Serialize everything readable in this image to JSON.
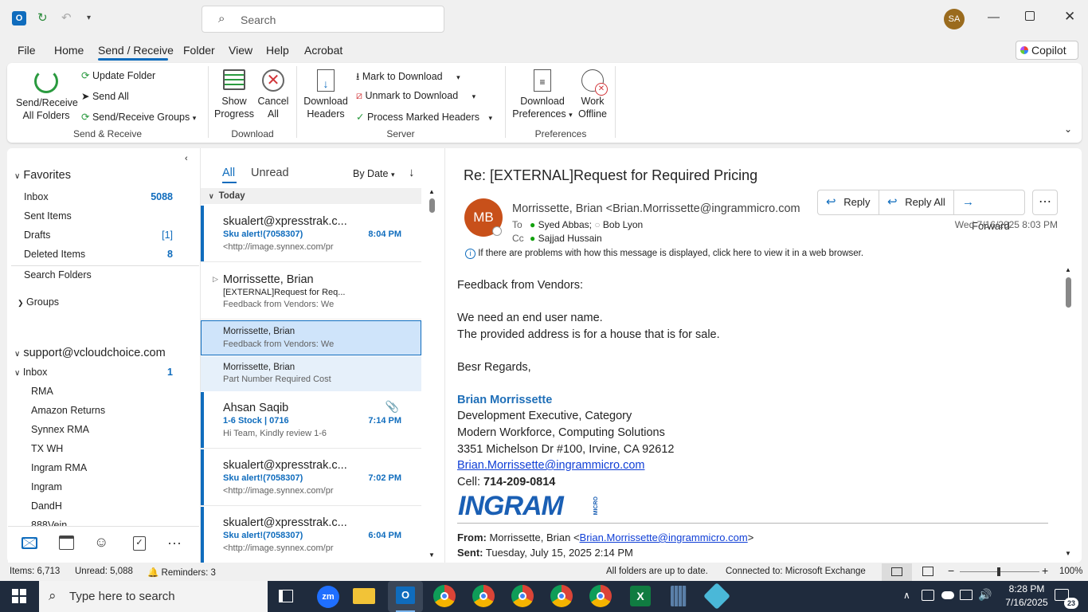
{
  "titlebar": {
    "search_placeholder": "Search",
    "avatar_initials": "SA"
  },
  "menu": {
    "tabs": [
      "File",
      "Home",
      "Send / Receive",
      "Folder",
      "View",
      "Help",
      "Acrobat"
    ],
    "active": "Send / Receive",
    "copilot_label": "Copilot"
  },
  "ribbon": {
    "send_receive_all": [
      "Send/Receive",
      "All Folders"
    ],
    "update_folder": "Update Folder",
    "send_all": "Send All",
    "send_receive_groups": "Send/Receive Groups",
    "group_send_receive": "Send & Receive",
    "show_progress": [
      "Show",
      "Progress"
    ],
    "cancel_all": [
      "Cancel",
      "All"
    ],
    "group_download": "Download",
    "download_headers": [
      "Download",
      "Headers"
    ],
    "mark_to_download": "Mark to Download",
    "unmark_to_download": "Unmark to Download",
    "process_marked_headers": "Process Marked Headers",
    "group_server": "Server",
    "download_preferences": [
      "Download",
      "Preferences"
    ],
    "work_offline": [
      "Work",
      "Offline"
    ],
    "group_preferences": "Preferences"
  },
  "nav": {
    "favorites_label": "Favorites",
    "favorites": [
      {
        "label": "Inbox",
        "count": "5088"
      },
      {
        "label": "Sent Items",
        "count": ""
      },
      {
        "label": "Drafts",
        "count": "[1]"
      },
      {
        "label": "Deleted Items",
        "count": "8"
      }
    ],
    "search_folders": "Search Folders",
    "groups_label": "Groups",
    "account": "support@vcloudchoice.com",
    "inbox_label": "Inbox",
    "inbox_count": "1",
    "subfolders": [
      "RMA",
      "Amazon Returns",
      "Synnex RMA",
      "TX WH",
      "Ingram RMA",
      "Ingram",
      "DandH",
      "888Vein"
    ]
  },
  "list": {
    "tab_all": "All",
    "tab_unread": "Unread",
    "sort_label": "By Date",
    "group_today": "Today",
    "messages": [
      {
        "from": "skualert@xpresstrak.c...",
        "subject": "Sku alert!(7058307)",
        "preview": "<http://image.synnex.com/pr",
        "time": "8:04 PM"
      },
      {
        "from": "Morrissette, Brian",
        "subject": "[EXTERNAL]Request for Req...",
        "preview": "Feedback from Vendors:  We",
        "time": ""
      },
      {
        "from": "Morrissette, Brian",
        "subject": "",
        "preview": "Feedback from Vendors:  We",
        "time": ""
      },
      {
        "from": "Morrissette, Brian",
        "subject": "",
        "preview": "Part Number  Required Cost",
        "time": ""
      },
      {
        "from": "Ahsan Saqib",
        "subject": "1-6 Stock | 0716",
        "preview": "Hi Team,  Kindly review 1-6",
        "time": "7:14 PM"
      },
      {
        "from": "skualert@xpresstrak.c...",
        "subject": "Sku alert!(7058307)",
        "preview": "<http://image.synnex.com/pr",
        "time": "7:02 PM"
      },
      {
        "from": "skualert@xpresstrak.c...",
        "subject": "Sku alert!(7058307)",
        "preview": "<http://image.synnex.com/pr",
        "time": "6:04 PM"
      }
    ]
  },
  "reading": {
    "subject": "Re: [EXTERNAL]Request for Required Pricing",
    "avatar_initials": "MB",
    "sender": "Morrissette, Brian <Brian.Morrissette@ingrammicro.com>",
    "to_label": "To",
    "to_1": "Syed Abbas;",
    "to_2": "Bob Lyon",
    "cc_label": "Cc",
    "cc_1": "Sajjad Hussain",
    "date": "Wed 7/16/2025 8:03 PM",
    "reply": "Reply",
    "reply_all": "Reply All",
    "forward": "Forward",
    "info_bar": "If there are problems with how this message is displayed, click here to view it in a web browser.",
    "body_1": "Feedback from Vendors:",
    "body_2": "We need an end user name.",
    "body_3": "The provided address is for a house that is for sale.",
    "body_4": "Besr Regards,",
    "sig_name": "Brian Morrissette",
    "sig_title": "Development Executive, Category",
    "sig_dept": "Modern Workforce, Computing Solutions",
    "sig_addr": "3351 Michelson Dr #100, Irvine, CA 92612",
    "sig_email": "Brian.Morrissette@ingrammicro.com",
    "sig_cell_label": "Cell:",
    "sig_cell": "714-209-0814",
    "logo_text": "INGRAM",
    "logo_sub": "MICRO",
    "quote_from_label": "From:",
    "quote_from_name": "Morrissette, Brian <",
    "quote_from_email": "Brian.Morrissette@ingrammicro.com",
    "quote_from_end": ">",
    "quote_sent_label": "Sent:",
    "quote_sent": "Tuesday, July 15, 2025 2:14 PM"
  },
  "status": {
    "items": "Items: 6,713",
    "unread": "Unread: 5,088",
    "reminders": "Reminders: 3",
    "sync": "All folders are up to date.",
    "connection": "Connected to: Microsoft Exchange",
    "zoom": "100%"
  },
  "taskbar": {
    "search_placeholder": "Type here to search",
    "time": "8:28 PM",
    "date": "7/16/2025",
    "notif_count": "23"
  }
}
